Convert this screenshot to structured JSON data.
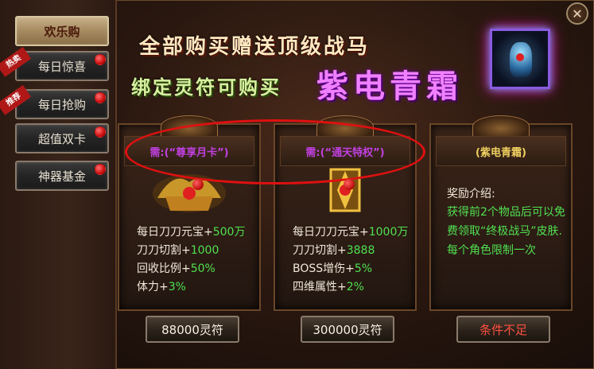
{
  "sidebar": {
    "title": "欢乐购",
    "items": [
      {
        "label": "每日惊喜",
        "tag": "热卖"
      },
      {
        "label": "每日抢购",
        "tag": "推荐"
      },
      {
        "label": "超值双卡",
        "tag": ""
      },
      {
        "label": "神器基金",
        "tag": ""
      }
    ]
  },
  "header": {
    "line1": "全部购买赠送顶级战马",
    "line2a": "绑定灵符可购买",
    "line2b": "紫电青霜"
  },
  "cards": [
    {
      "requirement": "需:(“尊享月卡”)",
      "stats": [
        {
          "label": "每日刀刀元宝+",
          "value": "500万"
        },
        {
          "label": "刀刀切割+",
          "value": "1000"
        },
        {
          "label": "回收比例+",
          "value": "50%"
        },
        {
          "label": "体力+",
          "value": "3%"
        }
      ],
      "price": "88000灵符"
    },
    {
      "requirement": "需:(“通天特权”)",
      "stats": [
        {
          "label": "每日刀刀元宝+",
          "value": "1000万"
        },
        {
          "label": "刀刀切割+",
          "value": "3888"
        },
        {
          "label": "BOSS增伤+",
          "value": "5%"
        },
        {
          "label": "四维属性+",
          "value": "2%"
        }
      ],
      "price": "300000灵符"
    },
    {
      "requirement": "(紫电青霜)",
      "reward_label": "奖励介绍:",
      "reward_text": "获得前2个物品后可以免费领取“终极战马”皮肤.\n每个角色限制一次",
      "price": "条件不足"
    }
  ],
  "colors": {
    "accent_red": "#e01010",
    "value_green": "#50e050",
    "title_purple": "#f080ff"
  }
}
